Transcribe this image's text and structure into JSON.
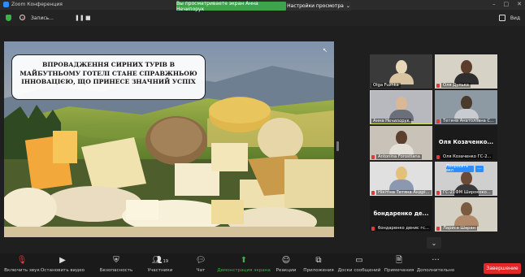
{
  "window": {
    "title": "Zoom Конференция",
    "controls": [
      "–",
      "□",
      "✕"
    ]
  },
  "banner": {
    "sharing_text": "Вы просматриваете экран Анна Нечипорук",
    "view_options": "Настройки просмотра"
  },
  "topbar": {
    "record_label": "Запись...",
    "pause_glyph": "❚❚",
    "stop_glyph": "■",
    "view_label": "Вид"
  },
  "slide": {
    "title": "Впровадження сирних турів в майбутньому готелі стане справжньою інновацією, що принесе значний успіх"
  },
  "participants": [
    {
      "name": "Olga Fuzhka",
      "muted": false
    },
    {
      "name": "Оля Дулька",
      "muted": true
    },
    {
      "name": "Анна Нечипорук",
      "muted": false,
      "active": true
    },
    {
      "name": "Тетяна Анатоліївна С...",
      "muted": true
    },
    {
      "name": "Antonina Forostiana",
      "muted": true
    },
    {
      "name": "Оля Козаченко ГС-2...",
      "big_name": "Оля Козаченко...",
      "muted": true
    },
    {
      "name": "Нікітіна Тетяна Андрі...",
      "muted": true
    },
    {
      "name": "ГС-21ФМ Ширококо...",
      "muted": true
    },
    {
      "name": "бондаренко денис гс...",
      "big_name": "бондаренко де...",
      "muted": true
    },
    {
      "name": "Лариса Шаран",
      "muted": true
    }
  ],
  "gallery": {
    "raise_hand": "Попросить вкл",
    "more": "···",
    "next": "⌄"
  },
  "toolbar": {
    "mute": "Включить звук",
    "video": "Остановить видео",
    "security": "Безопасность",
    "participants": "Участники",
    "participants_count": "19",
    "chat": "Чат",
    "share": "Демонстрация экрана",
    "reactions": "Реакции",
    "apps": "Приложения",
    "whiteboards": "Доски сообщений",
    "notes": "Примечания",
    "more": "Дополнительно",
    "end": "Завершение"
  },
  "colors": {
    "accent": "#2d8cff",
    "share_green": "#3fa34d",
    "end_red": "#e02828",
    "active_speaker": "#d8e04a"
  }
}
